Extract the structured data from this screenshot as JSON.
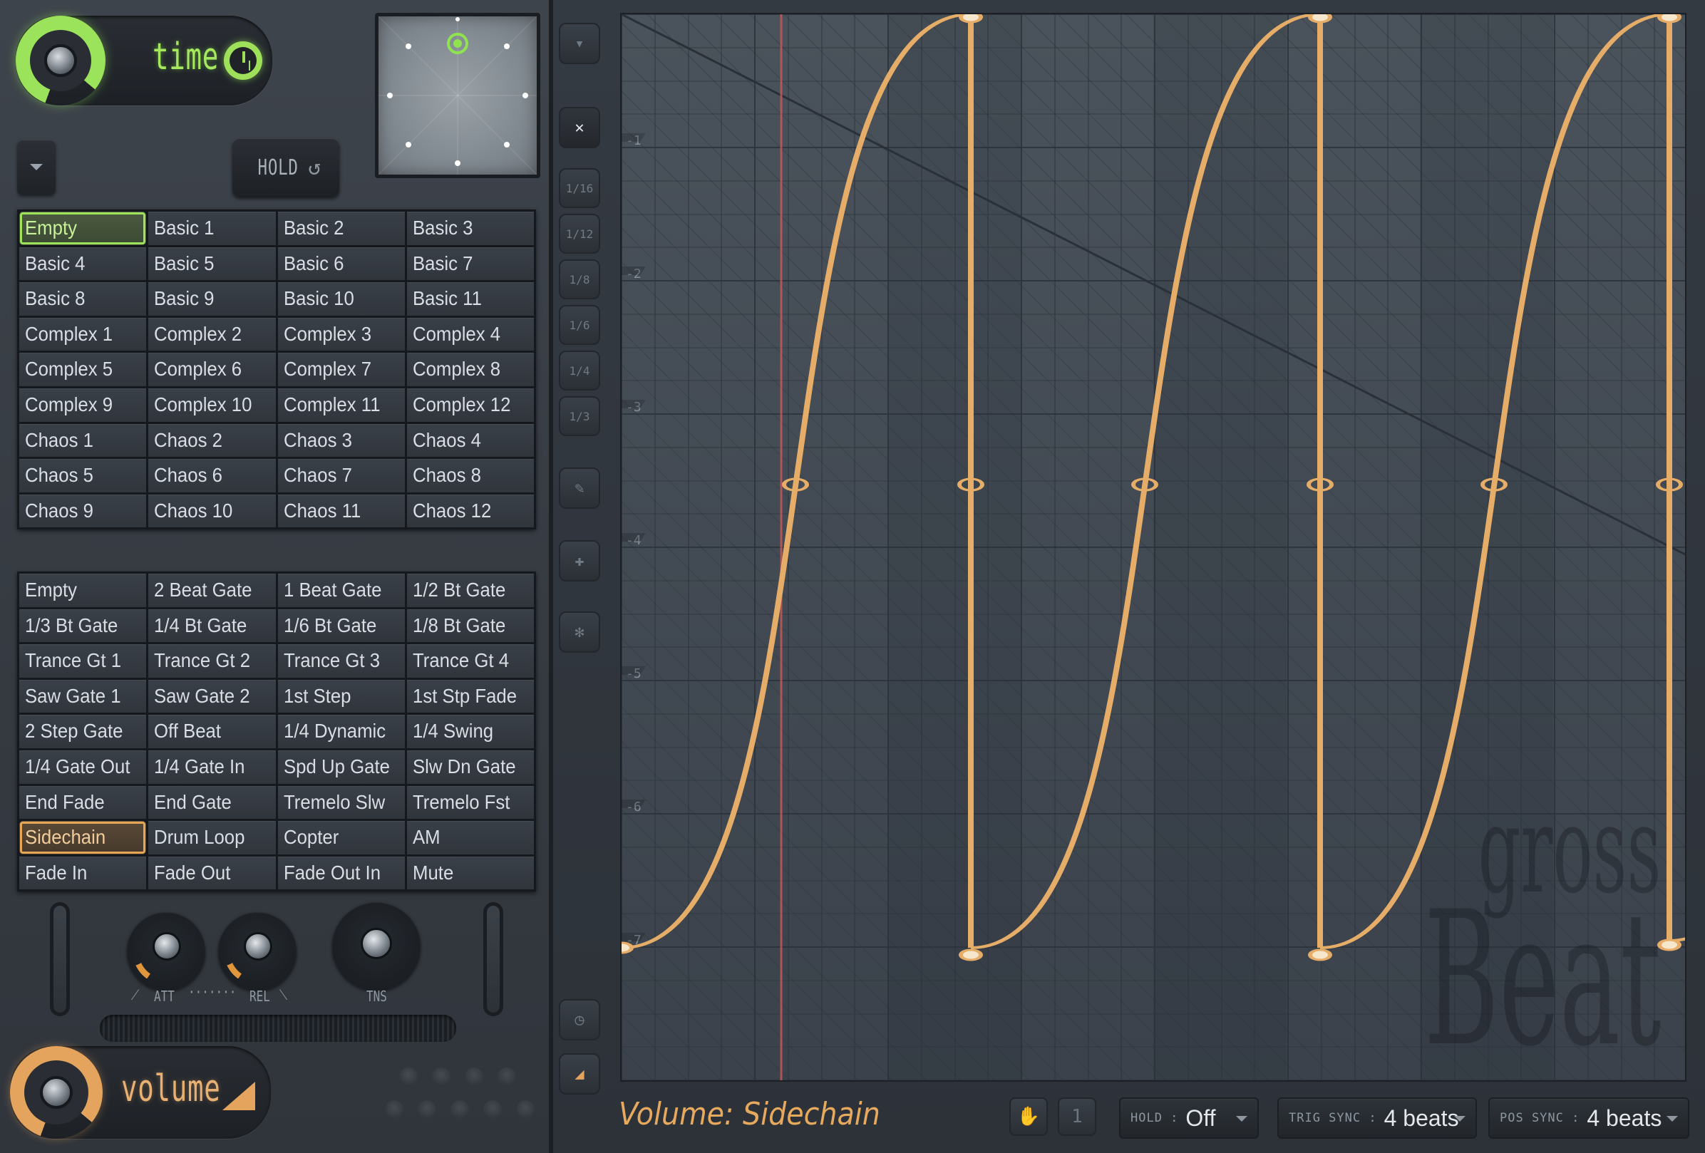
{
  "header": {
    "time_label": "time",
    "hold_label": "HOLD",
    "hold_arrow": "↺"
  },
  "time_presets": [
    "Empty",
    "Basic 1",
    "Basic 2",
    "Basic 3",
    "Basic 4",
    "Basic 5",
    "Basic 6",
    "Basic 7",
    "Basic 8",
    "Basic 9",
    "Basic 10",
    "Basic 11",
    "Complex 1",
    "Complex 2",
    "Complex 3",
    "Complex 4",
    "Complex 5",
    "Complex 6",
    "Complex 7",
    "Complex 8",
    "Complex 9",
    "Complex 10",
    "Complex 11",
    "Complex 12",
    "Chaos 1",
    "Chaos 2",
    "Chaos 3",
    "Chaos 4",
    "Chaos 5",
    "Chaos 6",
    "Chaos 7",
    "Chaos 8",
    "Chaos 9",
    "Chaos 10",
    "Chaos 11",
    "Chaos 12"
  ],
  "time_selected": "Empty",
  "volume_presets": [
    "Empty",
    "2 Beat Gate",
    "1 Beat Gate",
    "1/2 Bt Gate",
    "1/3 Bt Gate",
    "1/4 Bt Gate",
    "1/6 Bt Gate",
    "1/8 Bt Gate",
    "Trance Gt 1",
    "Trance Gt 2",
    "Trance Gt 3",
    "Trance Gt 4",
    "Saw Gate 1",
    "Saw Gate 2",
    "1st Step",
    "1st Stp Fade",
    "2 Step Gate",
    "Off Beat",
    "1/4 Dynamic",
    "1/4 Swing",
    "1/4 Gate Out",
    "1/4 Gate In",
    "Spd Up Gate",
    "Slw Dn Gate",
    "End Fade",
    "End Gate",
    "Tremelo Slw",
    "Tremelo Fst",
    "Sidechain",
    "Drum Loop",
    "Copter",
    "AM",
    "Fade In",
    "Fade Out",
    "Fade Out In",
    "Mute"
  ],
  "volume_selected": "Sidechain",
  "knobs": {
    "att": "ATT",
    "rel": "REL",
    "tns": "TNS",
    "att_rel_dots": "·······"
  },
  "volume_label": "volume",
  "toolbar": {
    "items": [
      {
        "name": "menu-down",
        "glyph": "▾"
      },
      {
        "name": "close",
        "glyph": "✕"
      },
      {
        "name": "snap-1-16",
        "glyph": "1/16"
      },
      {
        "name": "snap-1-12",
        "glyph": "1/12"
      },
      {
        "name": "snap-1-8",
        "glyph": "1/8"
      },
      {
        "name": "snap-1-6",
        "glyph": "1/6"
      },
      {
        "name": "snap-1-4",
        "glyph": "1/4"
      },
      {
        "name": "snap-1-3",
        "glyph": "1/3"
      },
      {
        "name": "draw-curve",
        "glyph": "✎"
      },
      {
        "name": "add-point",
        "glyph": "✚"
      },
      {
        "name": "snowflake",
        "glyph": "✻"
      },
      {
        "name": "clock",
        "glyph": "◷"
      },
      {
        "name": "volume-triangle",
        "glyph": "◢"
      }
    ]
  },
  "envelope": {
    "y_labels": [
      "-1",
      "-2",
      "-3",
      "-4",
      "-5",
      "-6",
      "-7"
    ],
    "watermark_1": "gross",
    "watermark_2": "Beat",
    "colors": {
      "curve": "#e6ad68",
      "playhead": "#c85a5a",
      "grid": "#2c333b"
    }
  },
  "status": {
    "label": "Volume: Sidechain"
  },
  "bottom_controls": {
    "hold_key": "HOLD :",
    "hold_value": "Off",
    "trig_key": "TRIG SYNC :",
    "trig_value": "4 beats",
    "pos_key": "POS SYNC :",
    "pos_value": "4 beats",
    "hand_icon": "✋",
    "one_icon": "1"
  }
}
